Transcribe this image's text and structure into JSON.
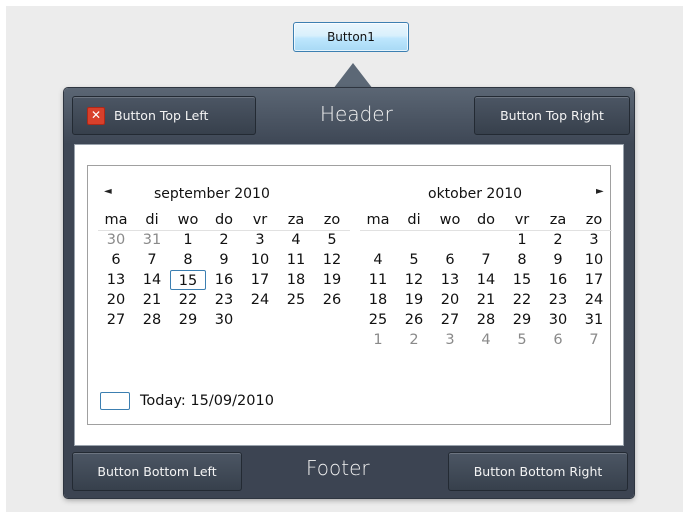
{
  "anchor_button": {
    "label": "Button1"
  },
  "popup": {
    "header": {
      "title": "Header",
      "left_button": "Button Top Left",
      "right_button": "Button Top Right"
    },
    "footer": {
      "title": "Footer",
      "left_button": "Button Bottom Left",
      "right_button": "Button Bottom Right"
    }
  },
  "calendar": {
    "prev_glyph": "◄",
    "next_glyph": "►",
    "weekdays": [
      "ma",
      "di",
      "wo",
      "do",
      "vr",
      "za",
      "zo"
    ],
    "months": [
      {
        "title": "september 2010",
        "weeks": [
          [
            "30",
            "31",
            "1",
            "2",
            "3",
            "4",
            "5"
          ],
          [
            "6",
            "7",
            "8",
            "9",
            "10",
            "11",
            "12"
          ],
          [
            "13",
            "14",
            "15",
            "16",
            "17",
            "18",
            "19"
          ],
          [
            "20",
            "21",
            "22",
            "23",
            "24",
            "25",
            "26"
          ],
          [
            "27",
            "28",
            "29",
            "30",
            "",
            "",
            ""
          ],
          [
            "",
            "",
            "",
            "",
            "",
            "",
            ""
          ]
        ],
        "dimmed": [
          [
            0,
            0
          ],
          [
            0,
            1
          ]
        ],
        "selected": [
          2,
          2
        ]
      },
      {
        "title": "oktober 2010",
        "weeks": [
          [
            "",
            "",
            "",
            "",
            "1",
            "2",
            "3"
          ],
          [
            "4",
            "5",
            "6",
            "7",
            "8",
            "9",
            "10"
          ],
          [
            "11",
            "12",
            "13",
            "14",
            "15",
            "16",
            "17"
          ],
          [
            "18",
            "19",
            "20",
            "21",
            "22",
            "23",
            "24"
          ],
          [
            "25",
            "26",
            "27",
            "28",
            "29",
            "30",
            "31"
          ],
          [
            "1",
            "2",
            "3",
            "4",
            "5",
            "6",
            "7"
          ]
        ],
        "dimmed": [
          [
            5,
            0
          ],
          [
            5,
            1
          ],
          [
            5,
            2
          ],
          [
            5,
            3
          ],
          [
            5,
            4
          ],
          [
            5,
            5
          ],
          [
            5,
            6
          ]
        ]
      }
    ],
    "today_label": "Today: 15/09/2010"
  },
  "colors": {
    "accent": "#3c7fb1",
    "popup_bg": "#3e4755",
    "close_icon": "#d8402b"
  }
}
